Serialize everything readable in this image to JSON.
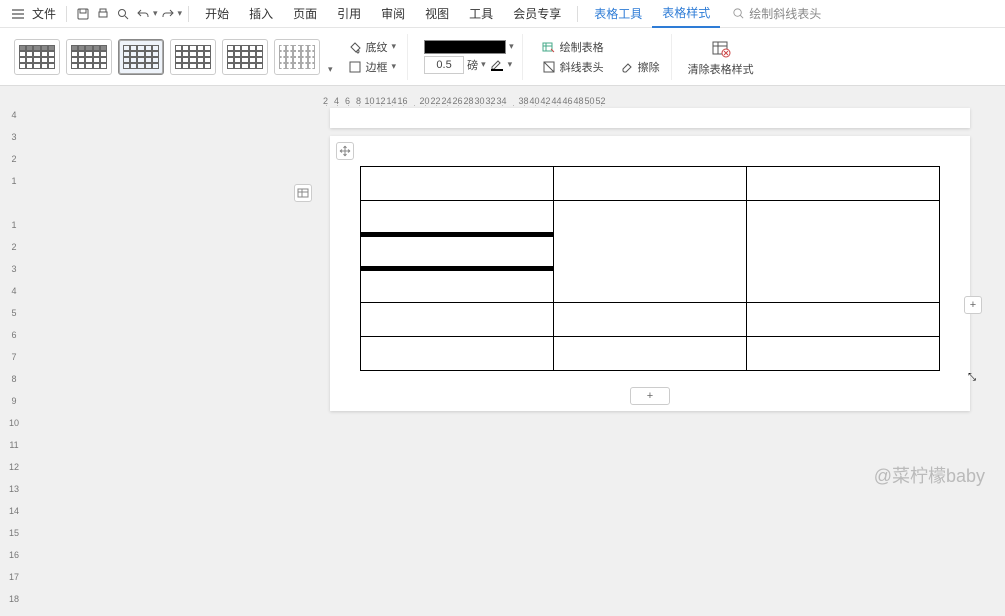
{
  "menubar": {
    "file": "文件",
    "tabs": [
      "开始",
      "插入",
      "页面",
      "引用",
      "审阅",
      "视图",
      "工具",
      "会员专享"
    ],
    "context_tabs": [
      "表格工具",
      "表格样式"
    ],
    "active_tab": "表格样式",
    "search_placeholder": "绘制斜线表头"
  },
  "ribbon": {
    "shading": "底纹",
    "border": "边框",
    "draw_table": "绘制表格",
    "diag_header": "斜线表头",
    "eraser": "擦除",
    "clear_style": "清除表格样式",
    "line_weight": "0.5",
    "line_unit": "磅"
  },
  "ruler": {
    "h": [
      "2",
      "4",
      "6",
      "8",
      "10",
      "12",
      "14",
      "16",
      "",
      "20",
      "22",
      "24",
      "26",
      "28",
      "30",
      "32",
      "34",
      "",
      "38",
      "40",
      "42",
      "44",
      "46",
      "48",
      "50",
      "52"
    ],
    "v": [
      "4",
      "3",
      "2",
      "1",
      "",
      "1",
      "2",
      "3",
      "4",
      "5",
      "6",
      "7",
      "8",
      "9",
      "10",
      "11",
      "12",
      "13",
      "14",
      "15",
      "16",
      "17",
      "18"
    ]
  },
  "watermark": "@菜柠檬baby",
  "table": {
    "rows": 6,
    "cols": 3
  }
}
